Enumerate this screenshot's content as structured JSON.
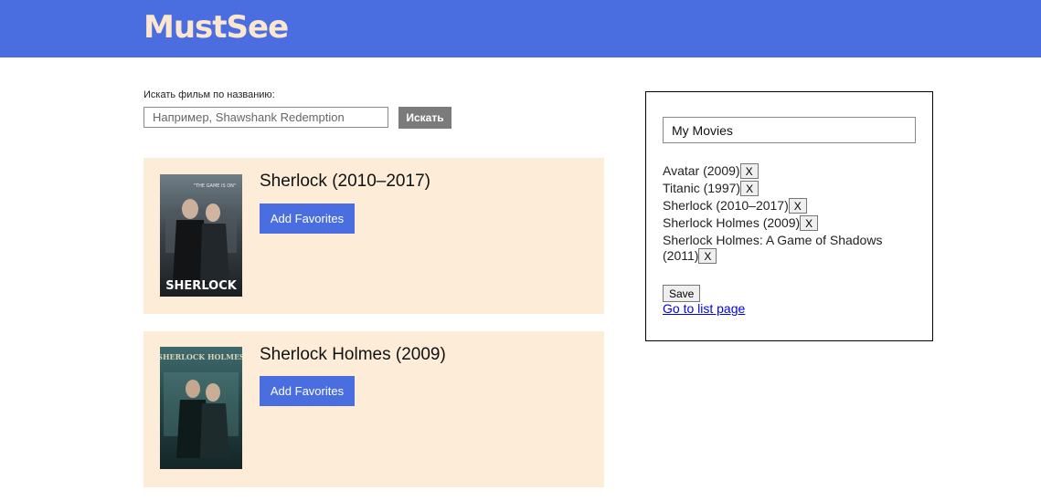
{
  "header": {
    "logo": "MustSee",
    "bg_color": "#4a6edf",
    "logo_color": "#fbe6cf"
  },
  "search": {
    "label": "Искать фильм по названию:",
    "placeholder": "Например, Shawshank Redemption",
    "value": "",
    "button_label": "Искать"
  },
  "results": [
    {
      "title": "Sherlock (2010–2017)",
      "button_label": "Add Favorites",
      "poster": {
        "tagline": "\"THE GAME IS ON\"",
        "name": "SHERLOCK"
      }
    },
    {
      "title": "Sherlock Holmes (2009)",
      "button_label": "Add Favorites",
      "poster": {
        "name": "SHERLOCK HOLMES"
      }
    }
  ],
  "favorites": {
    "list_name": "My Movies",
    "items": [
      "Avatar (2009)",
      "Titanic (1997)",
      "Sherlock (2010–2017)",
      "Sherlock Holmes (2009)",
      "Sherlock Holmes: A Game of Shadows (2011)"
    ],
    "remove_label": "X",
    "save_label": "Save",
    "link_label": "Go to list page"
  },
  "colors": {
    "accent": "#4a6edf",
    "card_bg": "#fdecd8",
    "search_button": "#7b7b7b"
  }
}
